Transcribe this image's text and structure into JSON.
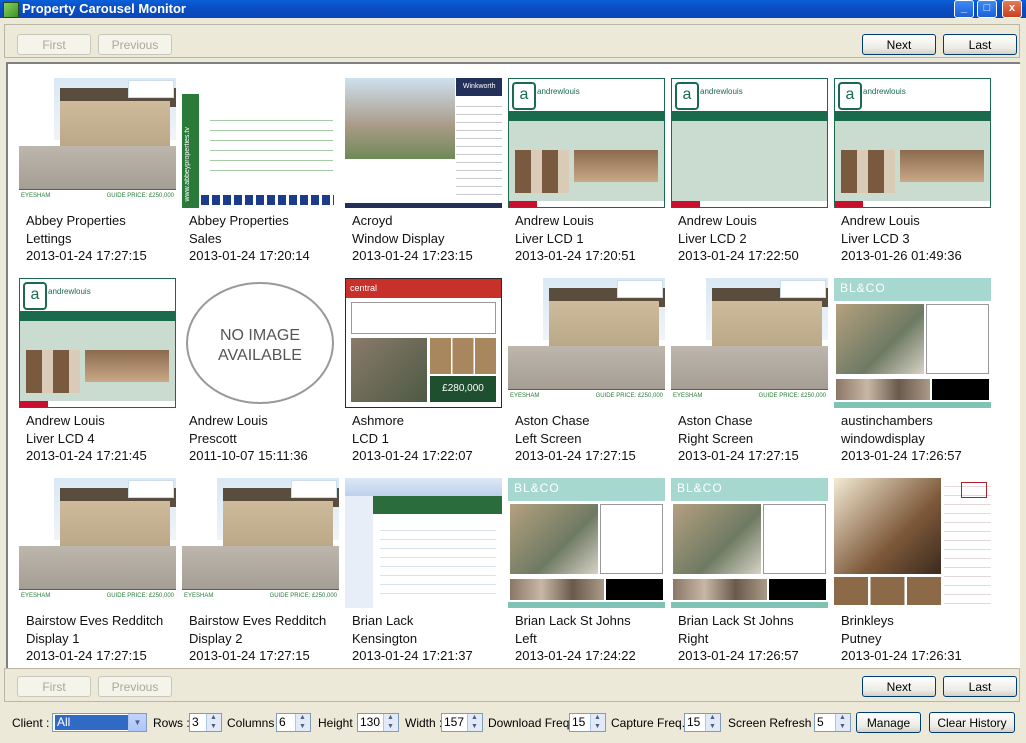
{
  "window": {
    "title": "Property Carousel Monitor",
    "min": "_",
    "max": "□",
    "close": "x"
  },
  "nav": {
    "first": "First",
    "previous": "Previous",
    "next": "Next",
    "last": "Last"
  },
  "cells": [
    {
      "line1": "Abbey Properties",
      "line2": "Lettings",
      "time": "2013-01-24 17:27:15",
      "style": "house"
    },
    {
      "line1": "Abbey Properties",
      "line2": "Sales",
      "time": "2013-01-24 17:20:14",
      "style": "abbeysales"
    },
    {
      "line1": "Acroyd",
      "line2": "Window Display",
      "time": "2013-01-24 17:23:15",
      "style": "acroyd"
    },
    {
      "line1": "Andrew Louis",
      "line2": "Liver LCD 1",
      "time": "2013-01-24 17:20:51",
      "style": "al"
    },
    {
      "line1": "Andrew Louis",
      "line2": "Liver LCD 2",
      "time": "2013-01-24 17:22:50",
      "style": "al2"
    },
    {
      "line1": "Andrew Louis",
      "line2": "Liver LCD 3",
      "time": "2013-01-26 01:49:36",
      "style": "al"
    },
    {
      "line1": "Andrew Louis",
      "line2": "Liver LCD 4",
      "time": "2013-01-24 17:21:45",
      "style": "al"
    },
    {
      "line1": "Andrew Louis",
      "line2": "Prescott",
      "time": "2011-10-07 15:11:36",
      "style": "noimage"
    },
    {
      "line1": "Ashmore",
      "line2": "LCD 1",
      "time": "2013-01-24 17:22:07",
      "style": "ashmore"
    },
    {
      "line1": "Aston Chase",
      "line2": "Left Screen",
      "time": "2013-01-24 17:27:15",
      "style": "house"
    },
    {
      "line1": "Aston Chase",
      "line2": "Right Screen",
      "time": "2013-01-24 17:27:15",
      "style": "house"
    },
    {
      "line1": "austinchambers",
      "line2": "windowdisplay",
      "time": "2013-01-24 17:26:57",
      "style": "blc"
    },
    {
      "line1": "Bairstow Eves Redditch",
      "line2": "Display 1",
      "time": "2013-01-24 17:27:15",
      "style": "house"
    },
    {
      "line1": "Bairstow Eves Redditch",
      "line2": "Display 2",
      "time": "2013-01-24 17:27:15",
      "style": "house"
    },
    {
      "line1": "Brian Lack",
      "line2": "Kensington",
      "time": "2013-01-24 17:21:37",
      "style": "browser"
    },
    {
      "line1": "Brian Lack St Johns",
      "line2": "Left",
      "time": "2013-01-24 17:24:22",
      "style": "blc"
    },
    {
      "line1": "Brian Lack St Johns",
      "line2": "Right",
      "time": "2013-01-24 17:26:57",
      "style": "blc"
    },
    {
      "line1": "Brinkleys",
      "line2": "Putney",
      "time": "2013-01-24 17:26:31",
      "style": "brinkleys"
    }
  ],
  "thumb_text": {
    "eyesham": "EYESHAM",
    "guide": "GUIDE PRICE: £250,000",
    "no_image": "NO IMAGE AVAILABLE",
    "al_brand": "andrewlouis",
    "blc_brand": "BL&CO",
    "ashmore_price": "£280,000",
    "ashmore_brand": "central",
    "abbey_side": "www.abbeyproperties.tv",
    "acroyd_brand": "Winkworth"
  },
  "controls": {
    "client_label": "Client :",
    "client_value": "All",
    "rows_label": "Rows :",
    "rows_value": "3",
    "columns_label": "Columns :",
    "columns_value": "6",
    "height_label": "Height :",
    "height_value": "130",
    "width_label": "Width :",
    "width_value": "157",
    "download_label": "Download Freq. :",
    "download_value": "15",
    "capture_label": "Capture Freq. :",
    "capture_value": "15",
    "refresh_label": "Screen Refresh :",
    "refresh_value": "5",
    "manage": "Manage",
    "clear_history": "Clear History"
  },
  "colors": {
    "title_bar": "#0a5fd8",
    "andrew_louis_green": "#1a6b4d",
    "blc_teal": "#a7d8cf"
  }
}
